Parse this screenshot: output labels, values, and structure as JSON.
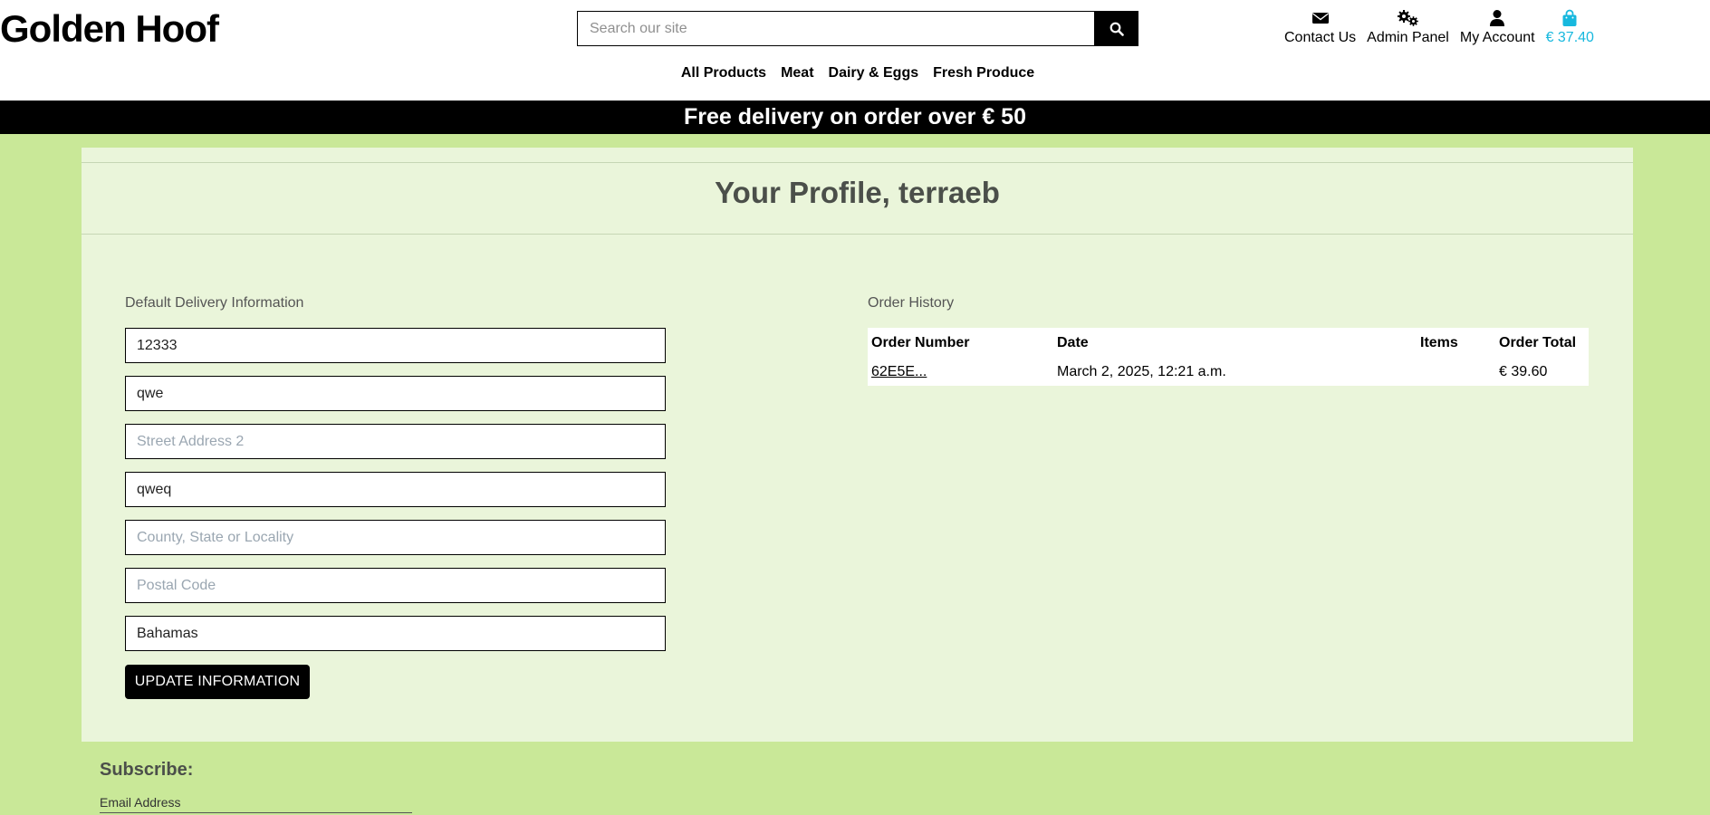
{
  "header": {
    "logo": "Golden Hoof",
    "search": {
      "placeholder": "Search our site",
      "value": ""
    },
    "nav": {
      "contact": "Contact Us",
      "admin": "Admin Panel",
      "account": "My Account",
      "cart": "€ 37.40"
    },
    "menu": [
      "All Products",
      "Meat",
      "Dairy & Eggs",
      "Fresh Produce"
    ]
  },
  "banner": "Free delivery on order over € 50",
  "profile": {
    "title": "Your Profile, terraeb",
    "delivery_label": "Default Delivery Information",
    "fields": [
      {
        "value": "12333",
        "placeholder": ""
      },
      {
        "value": "qwe",
        "placeholder": ""
      },
      {
        "value": "",
        "placeholder": "Street Address 2"
      },
      {
        "value": "qweq",
        "placeholder": ""
      },
      {
        "value": "",
        "placeholder": "County, State or Locality"
      },
      {
        "value": "",
        "placeholder": "Postal Code"
      },
      {
        "value": "Bahamas",
        "placeholder": ""
      }
    ],
    "update_button": "UPDATE INFORMATION",
    "history_label": "Order History",
    "orders": {
      "columns": [
        "Order Number",
        "Date",
        "Items",
        "Order Total"
      ],
      "rows": [
        {
          "number": "62E5E...",
          "date": "March 2, 2025, 12:21 a.m.",
          "items": "",
          "total": "€ 39.60"
        }
      ]
    }
  },
  "footer": {
    "subscribe_title": "Subscribe:",
    "email_label": "Email Address"
  },
  "colors": {
    "page_bg": "#c9e898",
    "panel_bg": "#eaf5da",
    "cart_accent": "#17b8de",
    "link": "#2b6fd6"
  }
}
